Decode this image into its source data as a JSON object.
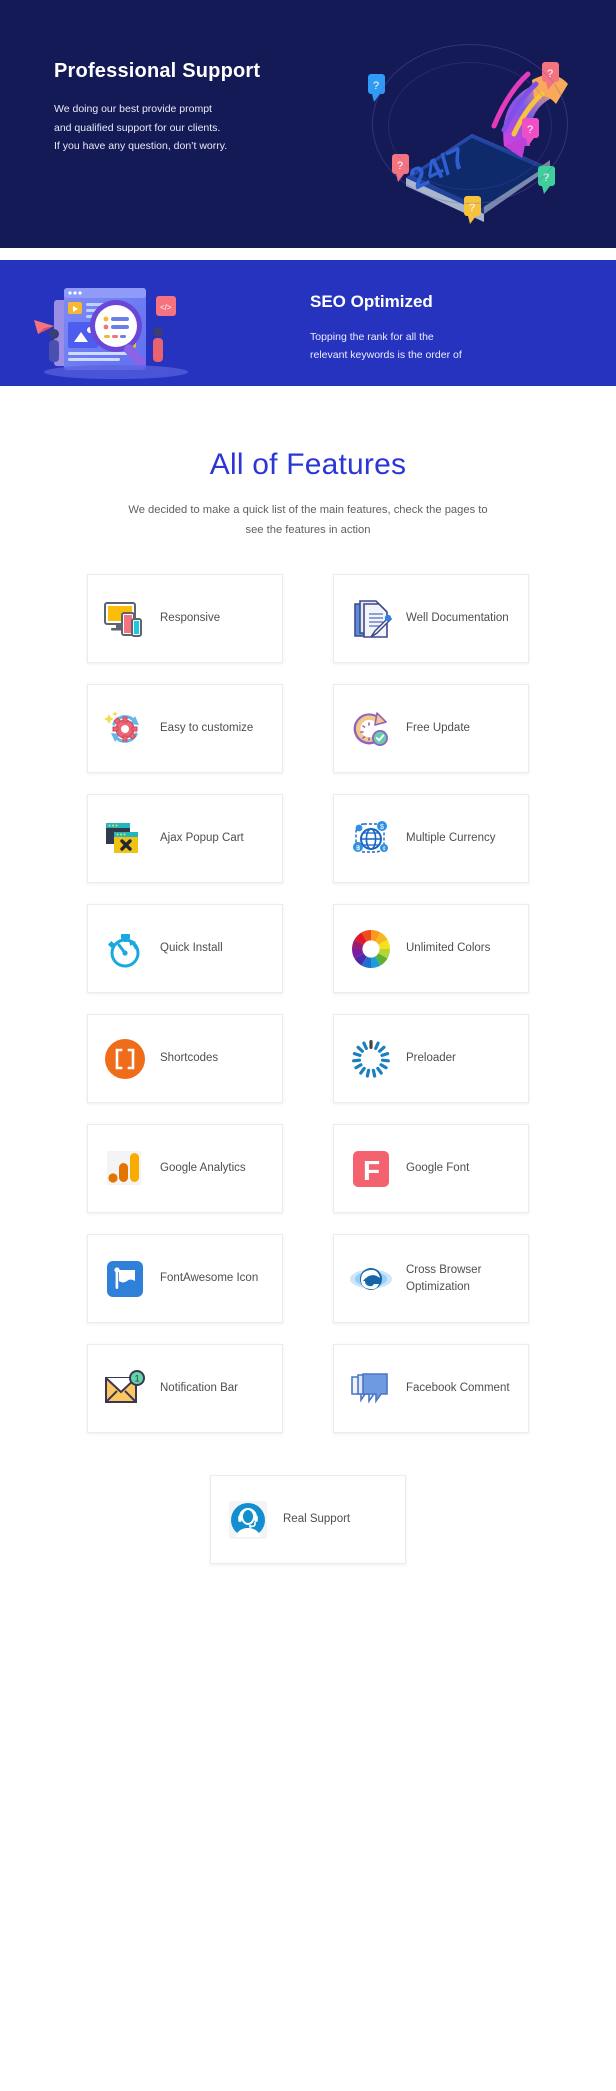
{
  "hero": {
    "title": "Professional Support",
    "body_line1": "We doing our best provide prompt",
    "body_line2": "and qualified support for our clients.",
    "body_line3": "If you have any question, don’t worry.",
    "art_badge": "24/7",
    "bg_color": "#141a56"
  },
  "seo": {
    "title": "SEO Optimized",
    "body_line1": "Topping the rank for all the",
    "body_line2": "relevant keywords is the order of",
    "bg_color": "#2533bf"
  },
  "features": {
    "title": "All of Features",
    "subtitle_line1": "We decided to make a quick list of the main features, check",
    "subtitle_line2": "the pages to see the features in action",
    "title_color": "#2a36d6",
    "items": [
      {
        "label": "Responsive",
        "icon": "monitor-devices-icon"
      },
      {
        "label": "Well Documentation",
        "icon": "documents-pen-icon"
      },
      {
        "label": "Easy to customize",
        "icon": "gear-refresh-icon"
      },
      {
        "label": "Free Update",
        "icon": "clock-check-icon"
      },
      {
        "label": "Ajax Popup Cart",
        "icon": "popup-windows-icon"
      },
      {
        "label": "Multiple Currency",
        "icon": "globe-currency-icon"
      },
      {
        "label": "Quick Install",
        "icon": "stopwatch-icon"
      },
      {
        "label": "Unlimited Colors",
        "icon": "color-wheel-icon"
      },
      {
        "label": "Shortcodes",
        "icon": "brackets-circle-icon"
      },
      {
        "label": "Preloader",
        "icon": "spinner-icon"
      },
      {
        "label": "Google Analytics",
        "icon": "analytics-bars-icon"
      },
      {
        "label": "Google Font",
        "icon": "font-f-icon"
      },
      {
        "label": "FontAwesome Icon",
        "icon": "flag-icon"
      },
      {
        "label": "Cross Browser Optimization",
        "icon": "browser-e-icon"
      },
      {
        "label": "Notification Bar",
        "icon": "envelope-badge-icon"
      },
      {
        "label": "Facebook Comment",
        "icon": "chat-bubbles-icon"
      },
      {
        "label": "Real Support",
        "icon": "headset-person-icon"
      }
    ]
  }
}
